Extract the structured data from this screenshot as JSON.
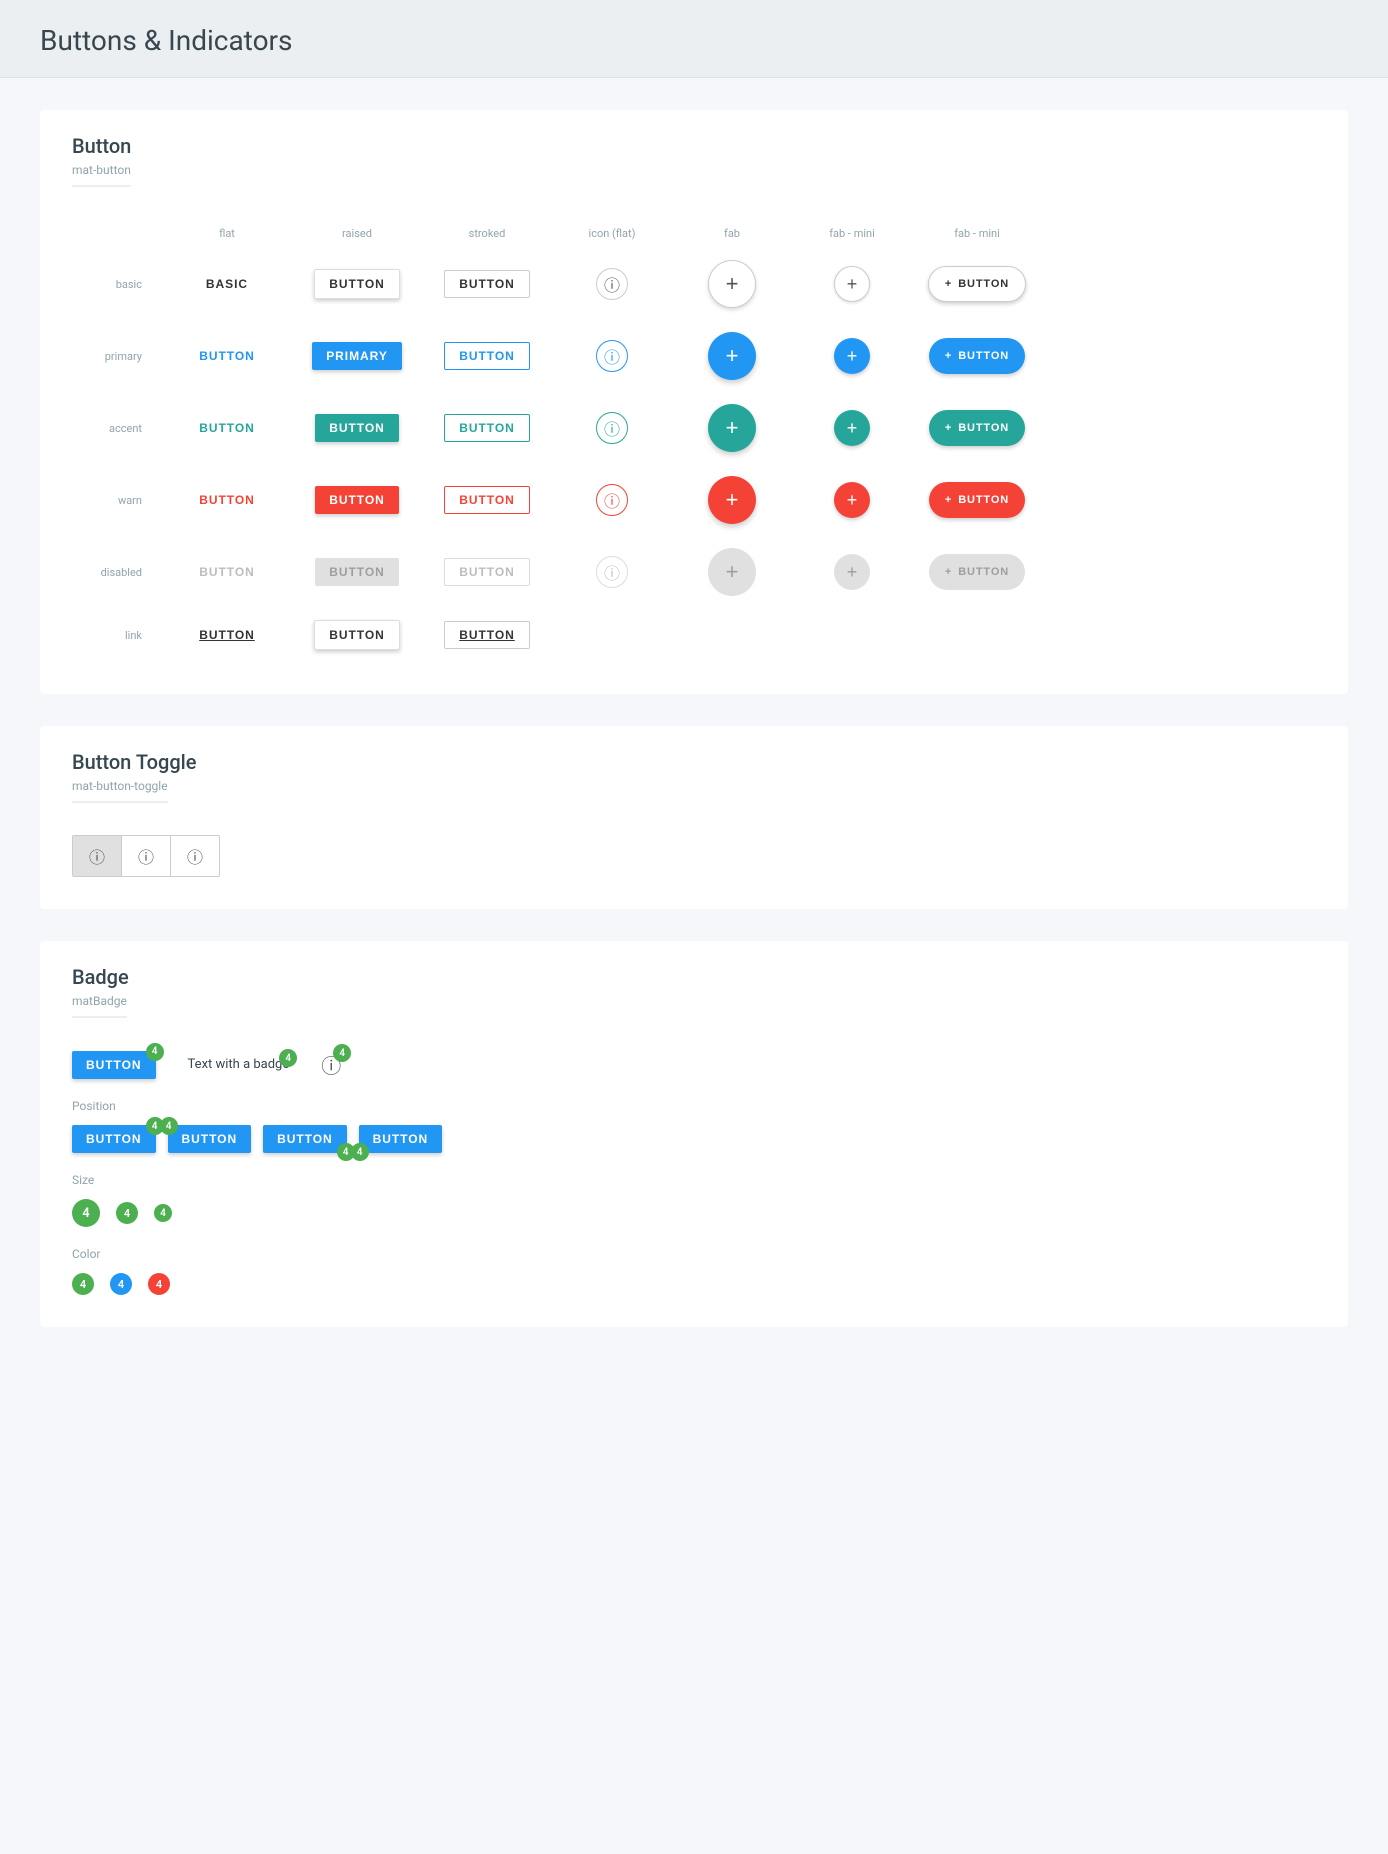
{
  "page": {
    "title": "Buttons & Indicators"
  },
  "buttonSection": {
    "title": "Button",
    "subtitle": "mat-button",
    "columns": [
      "flat",
      "raised",
      "stroked",
      "icon (flat)",
      "fab",
      "fab - mini",
      "fab - mini"
    ],
    "rows": [
      {
        "label": "basic",
        "flat": "BASIC",
        "raised": "BUTTON",
        "stroked": "BUTTON",
        "iconFlat": "ⓘ",
        "fab": "+",
        "fabMini": "+",
        "fabExt": "BUTTON"
      },
      {
        "label": "primary",
        "flat": "BUTTON",
        "raised": "PRIMARY",
        "stroked": "BUTTON",
        "iconFlat": "ⓘ",
        "fab": "+",
        "fabMini": "+",
        "fabExt": "BUTTON"
      },
      {
        "label": "accent",
        "flat": "BUTTON",
        "raised": "BUTTON",
        "stroked": "BUTTON",
        "iconFlat": "ⓘ",
        "fab": "+",
        "fabMini": "+",
        "fabExt": "BUTTON"
      },
      {
        "label": "warn",
        "flat": "BUTTON",
        "raised": "BUTTON",
        "stroked": "BUTTON",
        "iconFlat": "ⓘ",
        "fab": "+",
        "fabMini": "+",
        "fabExt": "BUTTON"
      },
      {
        "label": "disabled",
        "flat": "BUTTON",
        "raised": "BUTTON",
        "stroked": "BUTTON",
        "iconFlat": "ⓘ",
        "fab": "+",
        "fabMini": "+",
        "fabExt": "BUTTON"
      },
      {
        "label": "link",
        "flat": "BUTTON",
        "raised": "BUTTON",
        "stroked": "BUTTON"
      }
    ]
  },
  "toggleSection": {
    "title": "Button Toggle",
    "subtitle": "mat-button-toggle",
    "buttons": [
      "ⓘ",
      "ⓘ",
      "ⓘ"
    ]
  },
  "badgeSection": {
    "title": "Badge",
    "subtitle": "matBadge",
    "mainBadgeLabel": "BUTTON",
    "mainBadgeCount": "4",
    "textWithBadge": "Text with a badge",
    "textBadgeCount": "4",
    "iconBadgeCount": "4",
    "positionLabel": "Position",
    "positionButtons": [
      "BUTTON",
      "BUTTON",
      "BUTTON",
      "BUTTON"
    ],
    "positionBadgeCounts": [
      "4",
      "4",
      "4",
      "4"
    ],
    "sizeLabel": "Size",
    "sizeCircles": [
      {
        "size": 22,
        "count": "4"
      },
      {
        "size": 18,
        "count": "4"
      },
      {
        "size": 16,
        "count": "4"
      }
    ],
    "colorLabel": "Color",
    "colorCircles": [
      {
        "color": "#4caf50",
        "count": "4"
      },
      {
        "color": "#2196f3",
        "count": "4"
      },
      {
        "color": "#f44336",
        "count": "4"
      }
    ]
  }
}
